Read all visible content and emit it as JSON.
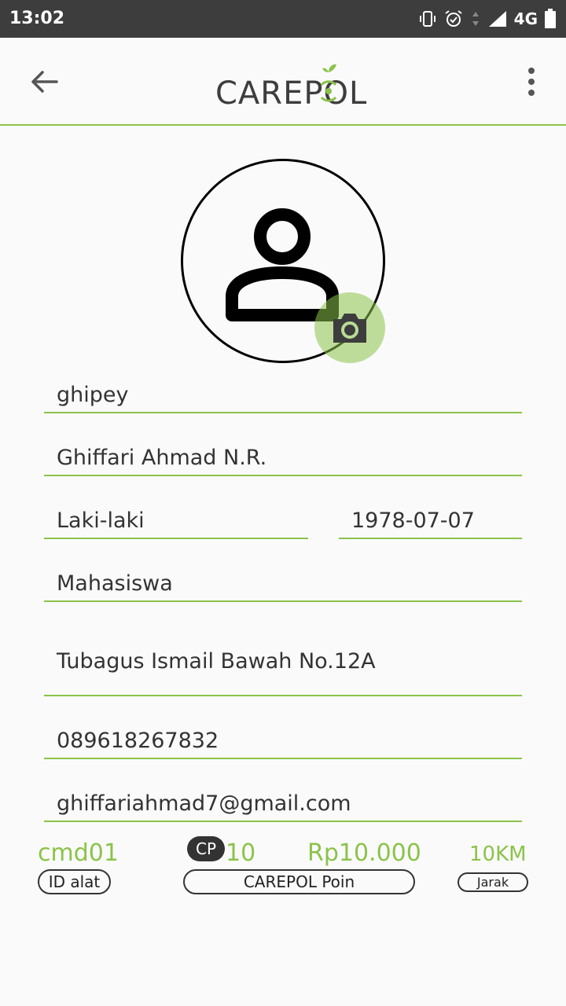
{
  "status_bar": {
    "time": "13:02",
    "network": "4G"
  },
  "app_bar": {
    "logo_text": "CAREPOL"
  },
  "profile": {
    "username": "ghipey",
    "full_name": "Ghiffari Ahmad N.R.",
    "gender": "Laki-laki",
    "birth_date": "1978-07-07",
    "occupation": "Mahasiswa",
    "address": "Tubagus Ismail Bawah No.12A",
    "phone": "089618267832",
    "email": "ghiffariahmad7@gmail.com"
  },
  "stats": {
    "device_id": "cmd01",
    "device_id_label": "ID alat",
    "cp_badge": "CP",
    "points": "10",
    "money": "Rp10.000",
    "points_label": "CAREPOL Poin",
    "distance": "10KM",
    "distance_label": "Jarak"
  },
  "colors": {
    "accent": "#8bc34a",
    "status_bar": "#3d3d3d",
    "text": "#333333"
  }
}
